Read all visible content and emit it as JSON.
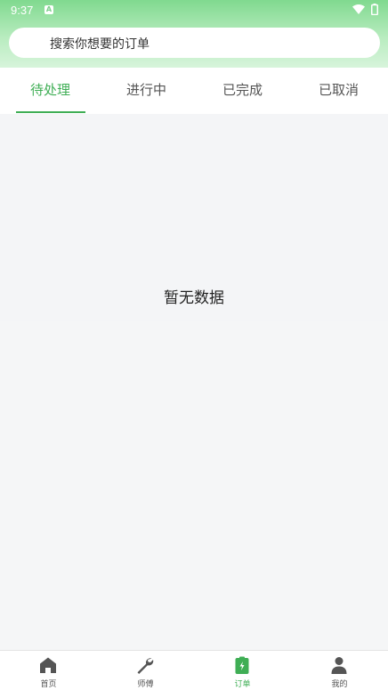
{
  "status_bar": {
    "time": "9:37",
    "notification_letter": "A"
  },
  "search": {
    "placeholder": "搜索你想要的订单"
  },
  "tabs": [
    {
      "label": "待处理",
      "active": true
    },
    {
      "label": "进行中",
      "active": false
    },
    {
      "label": "已完成",
      "active": false
    },
    {
      "label": "已取消",
      "active": false
    }
  ],
  "empty_state": {
    "text": "暂无数据"
  },
  "bottom_nav": [
    {
      "label": "首页",
      "icon": "home-icon",
      "active": false
    },
    {
      "label": "师傅",
      "icon": "wrench-icon",
      "active": false
    },
    {
      "label": "订单",
      "icon": "order-clipboard-icon",
      "active": true
    },
    {
      "label": "我的",
      "icon": "user-icon",
      "active": false
    }
  ],
  "colors": {
    "accent": "#3fae55",
    "header_gradient_top": "#80d98f",
    "header_gradient_bottom": "#d7f4db",
    "inactive_icon": "#555555",
    "background": "#f5f6f7"
  }
}
